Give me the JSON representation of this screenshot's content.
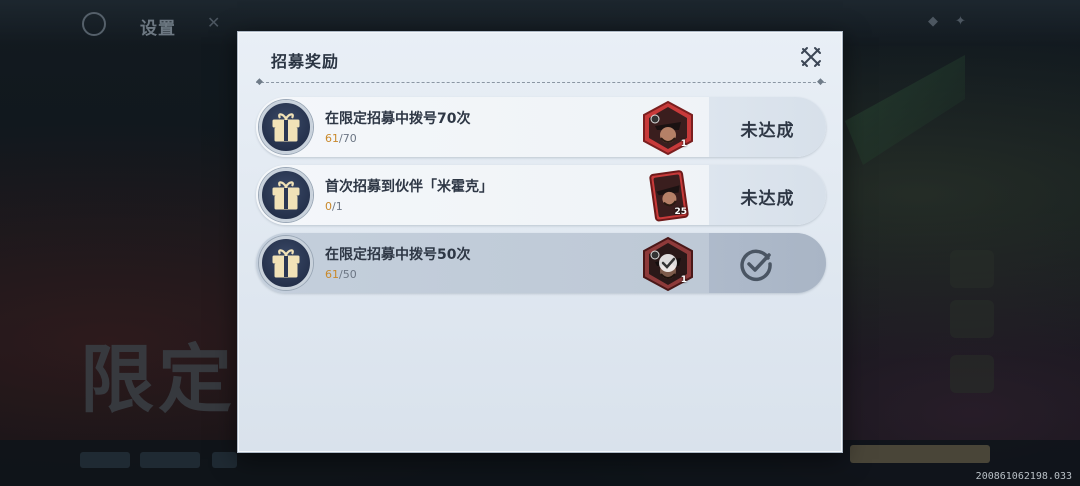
{
  "background": {
    "title": "设置",
    "big_text": "限定"
  },
  "modal": {
    "title": "招募奖励",
    "close_icon": "crossed-swords-icon"
  },
  "tasks": [
    {
      "title": "在限定招募中拨号70次",
      "progress_current": "61",
      "progress_total": "/70",
      "reward_icon": "character-portrait-hexagon-icon",
      "reward_count": "1",
      "status": "未达成",
      "claimed": false
    },
    {
      "title": "首次招募到伙伴「米霍克」",
      "progress_current": "0",
      "progress_total": "/1",
      "reward_icon": "character-card-icon",
      "reward_count": "25",
      "status": "未达成",
      "claimed": false
    },
    {
      "title": "在限定招募中拨号50次",
      "progress_current": "61",
      "progress_total": "/50",
      "reward_icon": "character-portrait-hexagon-icon",
      "reward_count": "1",
      "status": "",
      "status_icon": "checkmark-circle-icon",
      "claimed": true
    }
  ],
  "version": "200861062198.033",
  "colors": {
    "progress_current": "#c9892b",
    "gift_badge": "#2b3753",
    "modal_bg": "#e4ebf3"
  }
}
